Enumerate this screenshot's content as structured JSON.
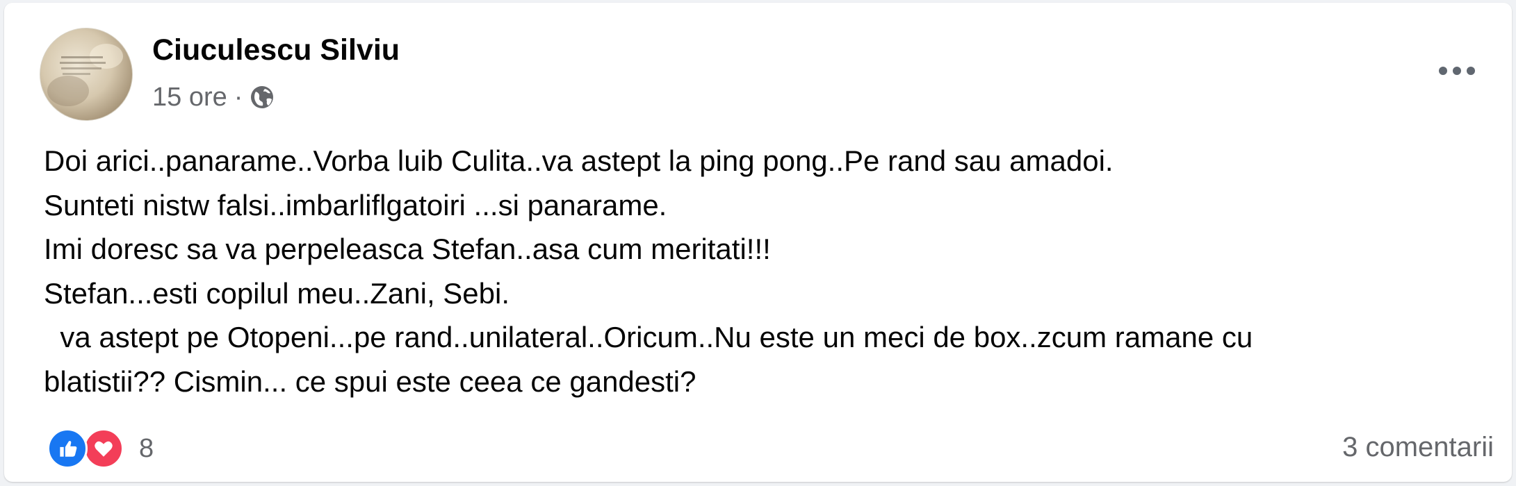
{
  "post": {
    "author": "Ciuculescu Silviu",
    "time": "15 ore",
    "separator": "·",
    "privacy_icon": "globe-icon",
    "more_icon": "more-options-icon",
    "lines": [
      "Doi arici..panarame..Vorba luib Culita..va astept la ping pong..Pe rand sau amadoi.",
      "Sunteti nistw falsi..imbarliflgatoiri ...si panarame.",
      "Imi doresc sa va perpeleasca Stefan..asa cum meritati!!!",
      "Stefan...esti copilul meu..Zani, Sebi.",
      "  va astept pe Otopeni...pe rand..unilateral..Oricum..Nu este un meci de box..zcum ramane cu",
      "blatistii?? Cismin... ce spui este ceea ce gandesti?"
    ]
  },
  "footer": {
    "reaction_icons": [
      "like-icon",
      "love-icon"
    ],
    "reaction_count": "8",
    "comments": "3 comentarii"
  },
  "colors": {
    "like": "#1877f2",
    "love": "#f33e58",
    "secondary_text": "#65676b",
    "primary_text": "#050505"
  }
}
